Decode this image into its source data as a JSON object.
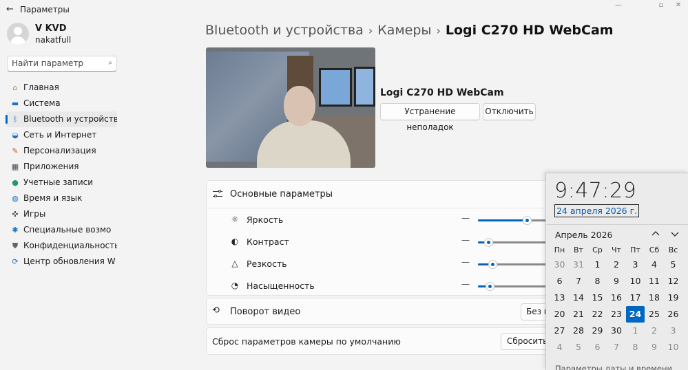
{
  "window": {
    "title": "Параметры",
    "back_icon": "back-arrow-icon"
  },
  "profile": {
    "name": "V KVD",
    "login": "nakatfull"
  },
  "search": {
    "placeholder": "Найти параметр",
    "icon": "search-icon"
  },
  "sidebar": {
    "items": [
      {
        "label": "Главная",
        "icon": "home-icon",
        "active": false
      },
      {
        "label": "Система",
        "icon": "system-icon",
        "active": false
      },
      {
        "label": "Bluetooth и устройств",
        "icon": "bluetooth-icon",
        "active": true
      },
      {
        "label": "Сеть и Интернет",
        "icon": "wifi-icon",
        "active": false
      },
      {
        "label": "Персонализация",
        "icon": "brush-icon",
        "active": false
      },
      {
        "label": "Приложения",
        "icon": "apps-icon",
        "active": false
      },
      {
        "label": "Учетные записи",
        "icon": "account-icon",
        "active": false
      },
      {
        "label": "Время и язык",
        "icon": "globe-icon",
        "active": false
      },
      {
        "label": "Игры",
        "icon": "gamepad-icon",
        "active": false
      },
      {
        "label": "Специальные возмо",
        "icon": "accessibility-icon",
        "active": false
      },
      {
        "label": "Конфиденциальность",
        "icon": "shield-icon",
        "active": false
      },
      {
        "label": "Центр обновления W",
        "icon": "update-icon",
        "active": false
      }
    ]
  },
  "breadcrumb": {
    "items": [
      "Bluetooth и устройства",
      "Камеры"
    ],
    "current": "Logi C270 HD WebCam"
  },
  "device": {
    "name": "Logi C270 HD WebCam",
    "troubleshoot_label": "Устранение неполадок",
    "disable_label": "Отключить"
  },
  "basic_settings": {
    "title": "Основные параметры",
    "params": [
      {
        "label": "Яркость",
        "icon": "brightness-icon",
        "level": 0.67
      },
      {
        "label": "Контраст",
        "icon": "contrast-icon",
        "level": 0.14
      },
      {
        "label": "Резкость",
        "icon": "sharpness-icon",
        "level": 0.2
      },
      {
        "label": "Насыщенность",
        "icon": "saturation-icon",
        "level": 0.16
      }
    ],
    "dash": "—"
  },
  "rotation": {
    "label": "Поворот видео",
    "value": "Без п",
    "icon": "rotate-camera-icon"
  },
  "reset": {
    "label": "Сброс параметров камеры по умолчанию",
    "button": "Сбросить"
  },
  "clock": {
    "time": "9:47:29",
    "date": "24 апреля 2026 г.",
    "month": "Апрель 2026",
    "weekdays": [
      "Пн",
      "Вт",
      "Ср",
      "Чт",
      "Пт",
      "Сб",
      "Вс"
    ],
    "weeks": [
      [
        "30",
        "31",
        "1",
        "2",
        "3",
        "4",
        "5"
      ],
      [
        "6",
        "7",
        "8",
        "9",
        "10",
        "11",
        "12"
      ],
      [
        "13",
        "14",
        "15",
        "16",
        "17",
        "18",
        "19"
      ],
      [
        "20",
        "21",
        "22",
        "23",
        "24",
        "25",
        "26"
      ],
      [
        "27",
        "28",
        "29",
        "30",
        "1",
        "2",
        "3"
      ],
      [
        "4",
        "5",
        "6",
        "7",
        "8",
        "9",
        "10"
      ]
    ],
    "today": "24",
    "footer": "Параметры даты и времени"
  }
}
